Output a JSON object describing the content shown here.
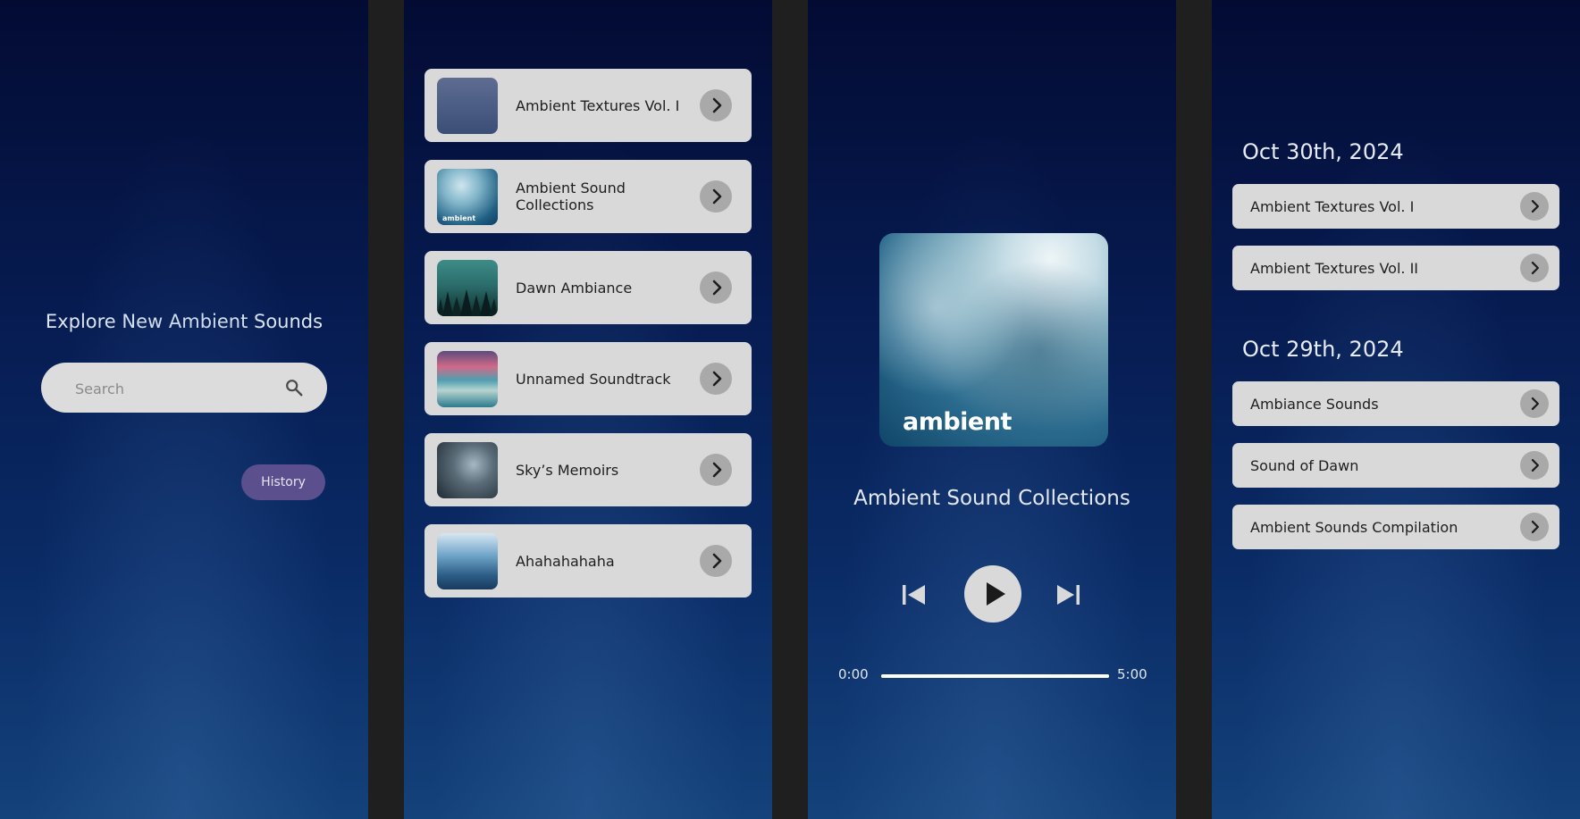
{
  "explore": {
    "title": "Explore New Ambient Sounds",
    "search_placeholder": "Search",
    "history_label": "History"
  },
  "library": {
    "albums": [
      {
        "title": "Ambient Textures Vol. I"
      },
      {
        "title": "Ambient Sound Collections",
        "thumb_text": "ambient"
      },
      {
        "title": "Dawn Ambiance"
      },
      {
        "title": "Unnamed Soundtrack"
      },
      {
        "title": "Sky’s Memoirs"
      },
      {
        "title": "Ahahahahaha"
      }
    ]
  },
  "player": {
    "cover_text": "ambient",
    "track_title": "Ambient Sound Collections",
    "current_time": "0:00",
    "total_time": "5:00",
    "progress_fraction": 1.0
  },
  "history": {
    "groups": [
      {
        "date": "Oct 30th, 2024",
        "items": [
          "Ambient Textures Vol. I",
          "Ambient Textures Vol. II"
        ]
      },
      {
        "date": "Oct 29th, 2024",
        "items": [
          "Ambiance Sounds",
          "Sound of Dawn",
          "Ambient Sounds Compilation"
        ]
      }
    ]
  },
  "colors": {
    "background_top": "#030b33",
    "background_bottom": "#14427a",
    "card": "#d9d9d9",
    "chevron_circle": "#a9a9a9",
    "history_button": "#5b4f8e"
  },
  "icons": {
    "search": "search-icon",
    "chevron": "chevron-right-icon",
    "previous": "skip-previous-icon",
    "play": "play-icon",
    "next": "skip-next-icon"
  }
}
